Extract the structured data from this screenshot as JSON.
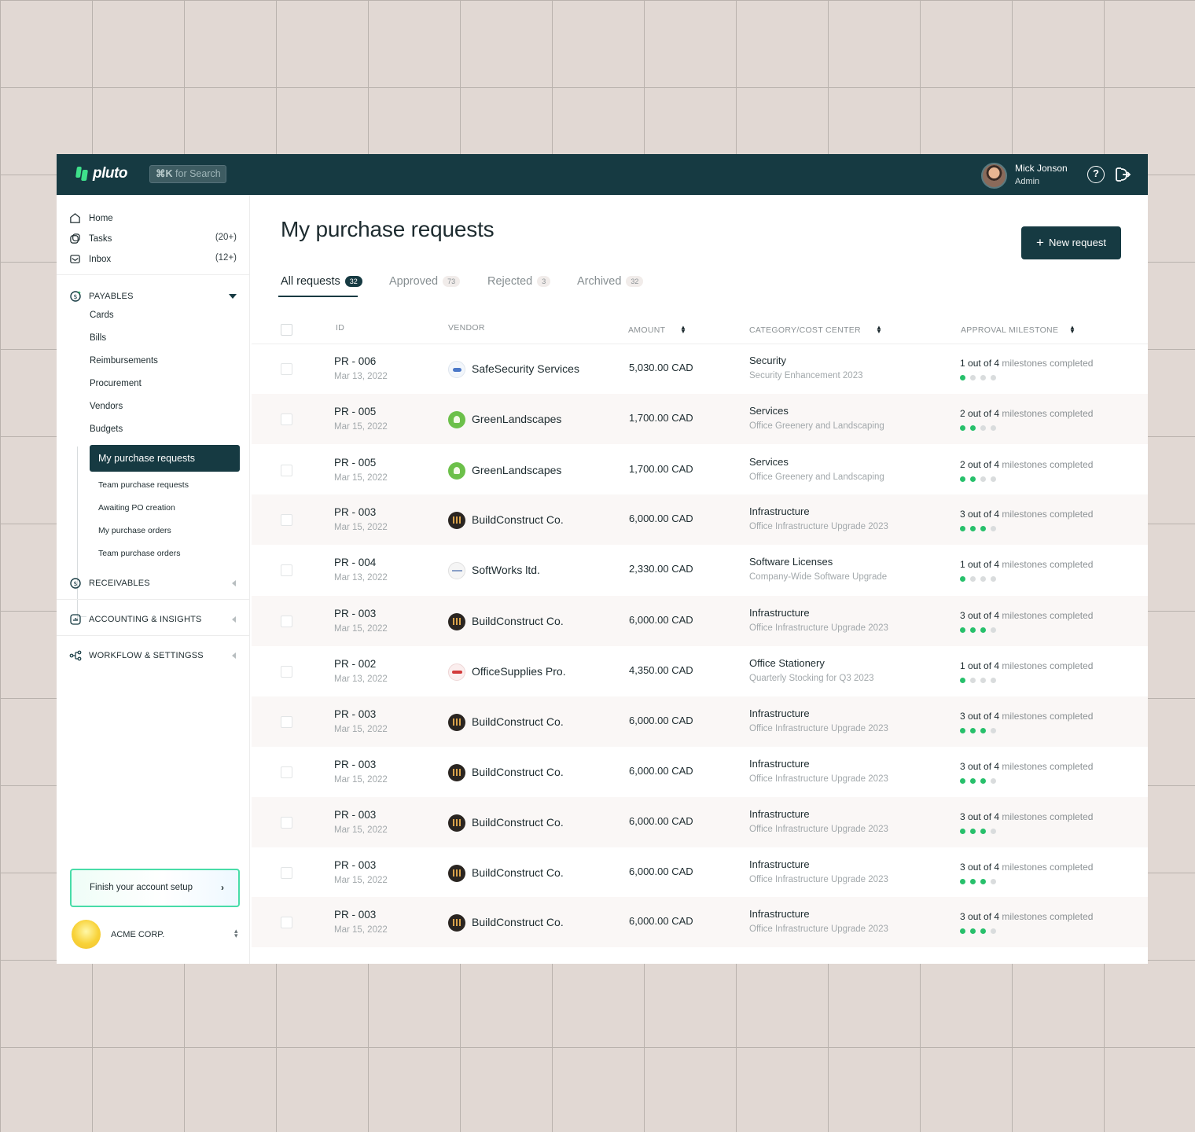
{
  "app": {
    "logo_text": "pluto",
    "search_key": "⌘K",
    "search_label": "for Search"
  },
  "user": {
    "name": "Mick Jonson",
    "role": "Admin"
  },
  "sidebar": {
    "nav": [
      {
        "label": "Home",
        "count": ""
      },
      {
        "label": "Tasks",
        "count": "(20+)"
      },
      {
        "label": "Inbox",
        "count": "(12+)"
      }
    ],
    "payables": {
      "title": "PAYABLES",
      "items": [
        "Cards",
        "Bills",
        "Reimbursements",
        "Procurement",
        "Vendors",
        "Budgets"
      ],
      "active": "My purchase requests",
      "sub_items": [
        "Team purchase requests",
        "Awaiting PO creation",
        "My purchase  orders",
        "Team purchase  orders"
      ]
    },
    "sections": [
      "RECEIVABLES",
      "ACCOUNTING & INSIGHTS",
      "WORKFLOW & SETTINGSS"
    ],
    "setup_label": "Finish your account setup",
    "org_name": "ACME CORP."
  },
  "main": {
    "title": "My purchase requests",
    "new_button": "New request",
    "tabs": [
      {
        "label": "All requests",
        "count": "32"
      },
      {
        "label": "Approved",
        "count": "73"
      },
      {
        "label": "Rejected",
        "count": "3"
      },
      {
        "label": "Archived",
        "count": "32"
      }
    ],
    "columns": [
      "ID",
      "VENDOR",
      "AMOUNT",
      "CATEGORY/COST CENTER",
      "APPROVAL MILESTONE"
    ],
    "ms_total": "out of 4",
    "ms_suffix": "milestones completed",
    "rows": [
      {
        "id": "PR - 006",
        "date": "Mar 13, 2022",
        "vendor": "SafeSecurity Services",
        "logo": "security",
        "amount": "5,030.00 CAD",
        "category": "Security",
        "cost_center": "Security Enhancement 2023",
        "done": "1"
      },
      {
        "id": "PR - 005",
        "date": "Mar 15, 2022",
        "vendor": "GreenLandscapes",
        "logo": "green",
        "amount": "1,700.00 CAD",
        "category": "Services",
        "cost_center": "Office Greenery and Landscaping",
        "done": "2"
      },
      {
        "id": "PR - 005",
        "date": "Mar 15, 2022",
        "vendor": "GreenLandscapes",
        "logo": "green",
        "amount": "1,700.00 CAD",
        "category": "Services",
        "cost_center": "Office Greenery and Landscaping",
        "done": "2"
      },
      {
        "id": "PR - 003",
        "date": "Mar 15, 2022",
        "vendor": "BuildConstruct Co.",
        "logo": "build",
        "amount": "6,000.00 CAD",
        "category": "Infrastructure",
        "cost_center": "Office Infrastructure Upgrade 2023",
        "done": "3"
      },
      {
        "id": "PR - 004",
        "date": "Mar 13, 2022",
        "vendor": "SoftWorks ltd.",
        "logo": "soft",
        "amount": "2,330.00 CAD",
        "category": "Software Licenses",
        "cost_center": "Company-Wide Software Upgrade",
        "done": "1"
      },
      {
        "id": "PR - 003",
        "date": "Mar 15, 2022",
        "vendor": "BuildConstruct Co.",
        "logo": "build",
        "amount": "6,000.00 CAD",
        "category": "Infrastructure",
        "cost_center": "Office Infrastructure Upgrade 2023",
        "done": "3"
      },
      {
        "id": "PR - 002",
        "date": "Mar 13, 2022",
        "vendor": "OfficeSupplies Pro.",
        "logo": "office",
        "amount": "4,350.00 CAD",
        "category": "Office Stationery",
        "cost_center": "Quarterly Stocking for Q3 2023",
        "done": "1"
      },
      {
        "id": "PR - 003",
        "date": "Mar 15, 2022",
        "vendor": "BuildConstruct Co.",
        "logo": "build",
        "amount": "6,000.00 CAD",
        "category": "Infrastructure",
        "cost_center": "Office Infrastructure Upgrade 2023",
        "done": "3"
      },
      {
        "id": "PR - 003",
        "date": "Mar 15, 2022",
        "vendor": "BuildConstruct Co.",
        "logo": "build",
        "amount": "6,000.00 CAD",
        "category": "Infrastructure",
        "cost_center": "Office Infrastructure Upgrade 2023",
        "done": "3"
      },
      {
        "id": "PR - 003",
        "date": "Mar 15, 2022",
        "vendor": "BuildConstruct Co.",
        "logo": "build",
        "amount": "6,000.00 CAD",
        "category": "Infrastructure",
        "cost_center": "Office Infrastructure Upgrade 2023",
        "done": "3"
      },
      {
        "id": "PR - 003",
        "date": "Mar 15, 2022",
        "vendor": "BuildConstruct Co.",
        "logo": "build",
        "amount": "6,000.00 CAD",
        "category": "Infrastructure",
        "cost_center": "Office Infrastructure Upgrade 2023",
        "done": "3"
      },
      {
        "id": "PR - 003",
        "date": "Mar 15, 2022",
        "vendor": "BuildConstruct Co.",
        "logo": "build",
        "amount": "6,000.00 CAD",
        "category": "Infrastructure",
        "cost_center": "Office Infrastructure Upgrade 2023",
        "done": "3"
      }
    ]
  }
}
